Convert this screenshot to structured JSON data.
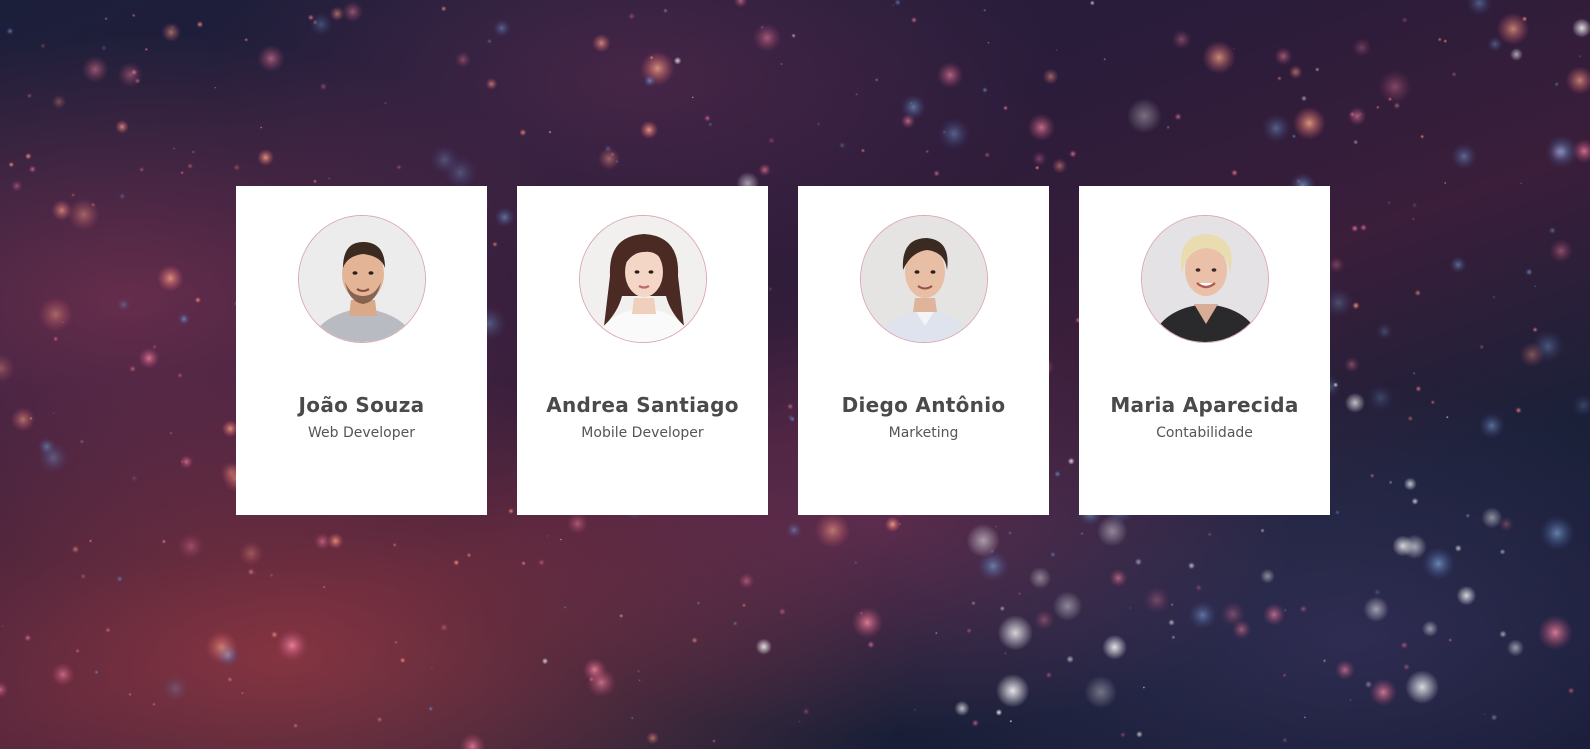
{
  "team": [
    {
      "name": "João Souza",
      "role": "Web Developer",
      "avatar_icon": "man-short-dark-hair-beard-avatar"
    },
    {
      "name": "Andrea Santiago",
      "role": "Mobile Developer",
      "avatar_icon": "woman-long-dark-hair-avatar"
    },
    {
      "name": "Diego Antônio",
      "role": "Marketing",
      "avatar_icon": "man-dark-hair-collared-shirt-avatar"
    },
    {
      "name": "Maria Aparecida",
      "role": "Contabilidade",
      "avatar_icon": "woman-blonde-short-hair-avatar"
    }
  ],
  "colors": {
    "card_bg": "#ffffff",
    "name_text": "#4a4a4a",
    "role_text": "#555555",
    "avatar_border": "#d9a7b5"
  }
}
